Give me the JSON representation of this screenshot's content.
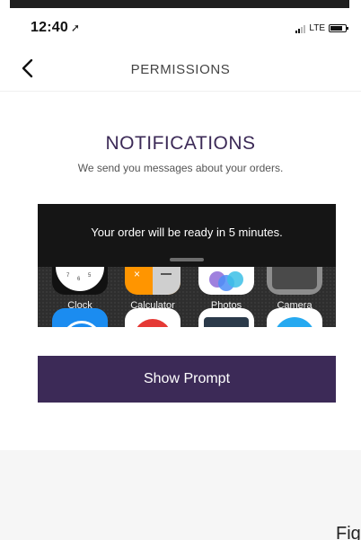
{
  "status_bar": {
    "time": "12:40",
    "location_arrow": "➚",
    "network": "LTE"
  },
  "nav": {
    "back_glyph": "back-chevron-icon",
    "title": "PERMISSIONS"
  },
  "content": {
    "heading": "NOTIFICATIONS",
    "subtext": "We send you messages about your orders."
  },
  "preview": {
    "notification_text": "Your order will be ready in 5 minutes.",
    "apps": [
      {
        "label": "Clock",
        "icon": "clock-icon"
      },
      {
        "label": "Calculator",
        "icon": "calculator-icon"
      },
      {
        "label": "Photos",
        "icon": "photos-icon"
      },
      {
        "label": "Camera",
        "icon": "camera-icon"
      }
    ]
  },
  "actions": {
    "show_prompt_label": "Show Prompt"
  },
  "corner_text": "Fig",
  "colors": {
    "brand_purple": "#3c2a57",
    "notification_bg": "#151515",
    "calculator_orange": "#ff9500"
  }
}
